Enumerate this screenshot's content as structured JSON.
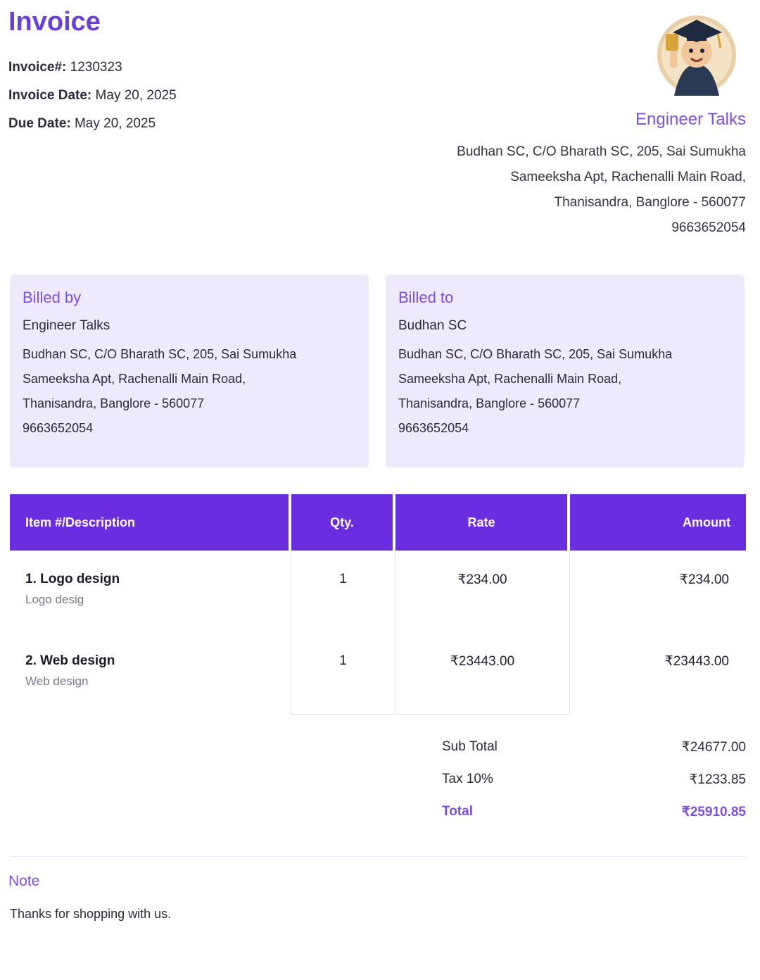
{
  "header": {
    "title": "Invoice",
    "invoice_no_label": "Invoice#:",
    "invoice_no": "1230323",
    "invoice_date_label": "Invoice Date:",
    "invoice_date": "May 20, 2025",
    "due_date_label": "Due Date:",
    "due_date": "May 20, 2025"
  },
  "business": {
    "name": "Engineer Talks",
    "address_lines": [
      "Budhan SC, C/O Bharath SC, 205, Sai Sumukha",
      "Sameeksha Apt, Rachenalli Main Road,",
      "Thanisandra, Banglore - 560077",
      "9663652054"
    ]
  },
  "billed_by": {
    "heading": "Billed by",
    "name": "Engineer Talks",
    "address_lines": [
      "Budhan SC, C/O Bharath SC, 205, Sai Sumukha",
      "Sameeksha Apt, Rachenalli Main Road,",
      "Thanisandra, Banglore - 560077",
      "9663652054"
    ]
  },
  "billed_to": {
    "heading": "Billed to",
    "name": "Budhan SC",
    "address_lines": [
      "Budhan SC, C/O Bharath SC, 205, Sai Sumukha",
      "Sameeksha Apt, Rachenalli Main Road,",
      "Thanisandra, Banglore - 560077",
      "9663652054"
    ]
  },
  "table": {
    "headers": [
      "Item #/Description",
      "Qty.",
      "Rate",
      "Amount"
    ],
    "items": [
      {
        "name": "1. Logo design",
        "desc": "Logo desig",
        "qty": "1",
        "rate": "₹234.00",
        "amount": "₹234.00"
      },
      {
        "name": "2. Web design",
        "desc": "Web design",
        "qty": "1",
        "rate": "₹23443.00",
        "amount": "₹23443.00"
      }
    ]
  },
  "totals": {
    "subtotal_label": "Sub Total",
    "subtotal": "₹24677.00",
    "tax_label": "Tax 10%",
    "tax": "₹1233.85",
    "total_label": "Total",
    "total": "₹25910.85"
  },
  "note": {
    "heading": "Note",
    "text": "Thanks for shopping with us."
  },
  "colors": {
    "accent": "#6a2de0",
    "accent_text": "#7b4fe0",
    "card_bg": "#efeafb"
  }
}
